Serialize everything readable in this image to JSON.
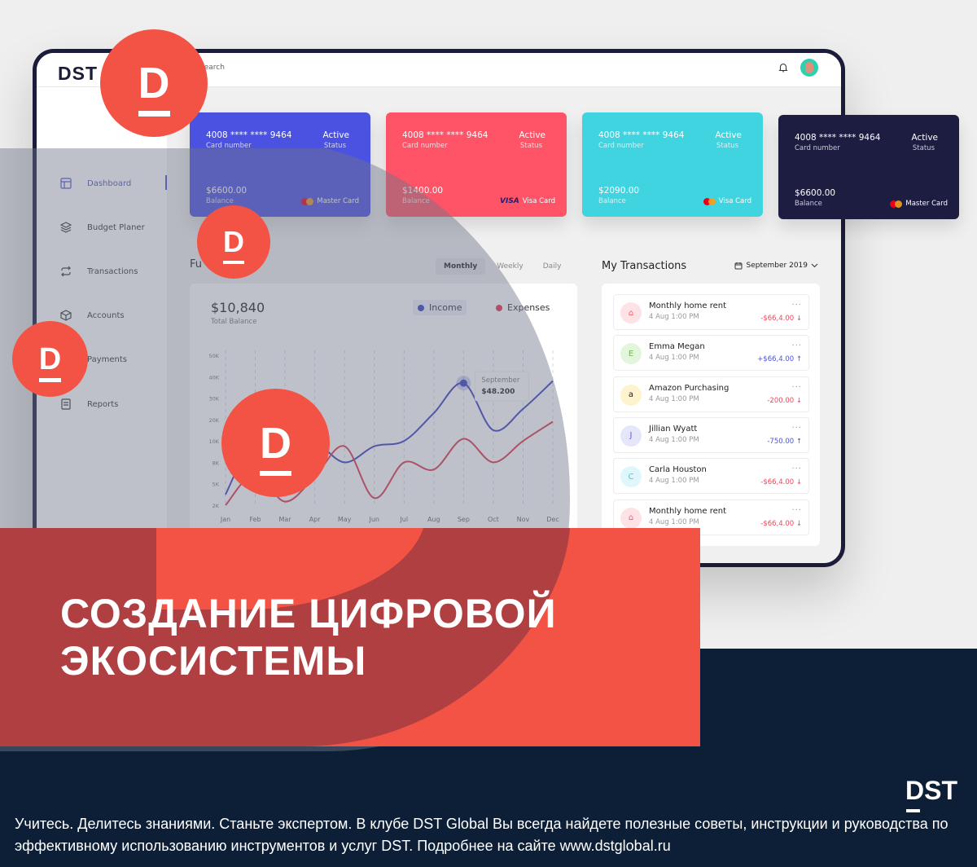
{
  "app": {
    "logo": "DST",
    "search_placeholder": "Search"
  },
  "sidebar": {
    "items": [
      {
        "label": "Dashboard",
        "icon": "layout-icon",
        "active": true
      },
      {
        "label": "Budget Planer",
        "icon": "layers-icon"
      },
      {
        "label": "Transactions",
        "icon": "repeat-icon"
      },
      {
        "label": "Accounts",
        "icon": "box-icon"
      },
      {
        "label": "Payments",
        "icon": "credit-card-icon"
      },
      {
        "label": "Reports",
        "icon": "report-icon"
      }
    ]
  },
  "cards": [
    {
      "number": "4008 **** **** 9464",
      "number_label": "Card number",
      "status": "Active",
      "status_label": "Status",
      "balance": "$6600.00",
      "balance_label": "Balance",
      "brand": "Master Card",
      "color": "#4b51e0"
    },
    {
      "number": "4008 **** **** 9464",
      "number_label": "Card number",
      "status": "Active",
      "status_label": "Status",
      "balance": "$1400.00",
      "balance_label": "Balance",
      "brand": "Visa Card",
      "brand_mark": "VISA",
      "color": "#ff5468"
    },
    {
      "number": "4008 **** **** 9464",
      "number_label": "Card number",
      "status": "Active",
      "status_label": "Status",
      "balance": "$2090.00",
      "balance_label": "Balance",
      "brand": "Visa Card",
      "color": "#3fd4e0"
    },
    {
      "number": "4008 **** **** 9464",
      "number_label": "Card number",
      "status": "Active",
      "status_label": "Status",
      "balance": "$6600.00",
      "balance_label": "Balance",
      "brand": "Master Card",
      "color": "#1d1d42"
    }
  ],
  "funds": {
    "title": "Funds Overview",
    "visible_title_prefix": "Fu",
    "visible_title_suffix": "w",
    "tabs": [
      "Monthly",
      "Weekly",
      "Daily"
    ],
    "active_tab": "Monthly",
    "total": "$10,840",
    "total_label": "Total Balance",
    "legend": [
      {
        "label": "Income",
        "color": "#3a3fc4"
      },
      {
        "label": "Expenses",
        "color": "#e0344f"
      }
    ],
    "tooltip": {
      "month": "September",
      "value": "$48.200"
    }
  },
  "chart_data": {
    "type": "line",
    "title": "",
    "xlabel": "",
    "ylabel": "",
    "categories": [
      "Jan",
      "Feb",
      "Mar",
      "Apr",
      "May",
      "Jun",
      "Jul",
      "Aug",
      "Sep",
      "Oct",
      "Nov",
      "Dec"
    ],
    "y_ticks": [
      "2K",
      "5K",
      "8K",
      "10K",
      "20K",
      "30K",
      "40K",
      "50K"
    ],
    "series": [
      {
        "name": "Income",
        "color": "#3a3fc4",
        "values": [
          3.5,
          12,
          14,
          10,
          8,
          9.5,
          10,
          23,
          37,
          15,
          25,
          38
        ]
      },
      {
        "name": "Expenses",
        "color": "#e0344f",
        "values": [
          2,
          6.5,
          2.5,
          6,
          9.5,
          3,
          8,
          7,
          11,
          8,
          10,
          19
        ]
      }
    ],
    "highlight": {
      "series": "Income",
      "category": "Sep",
      "label": "September",
      "value": "$48.200"
    },
    "grid": "vertical-dashed",
    "legend_position": "top-right"
  },
  "transactions": {
    "title": "My Transactions",
    "period": "September 2019",
    "items": [
      {
        "name": "Monthly home rent",
        "time": "4 Aug 1:00 PM",
        "amount": "-$66,4.00 ↓",
        "type": "out",
        "avatar": "airbnb",
        "avatar_bg": "#fde3e6",
        "avatar_fg": "#f05a6a"
      },
      {
        "name": "Emma Megan",
        "time": "4 Aug 1:00 PM",
        "amount": "+$66,4.00 ↑",
        "type": "in",
        "avatar": "E",
        "avatar_bg": "#e3f5dc",
        "avatar_fg": "#6bbf3c"
      },
      {
        "name": "Amazon Purchasing",
        "time": "4 Aug 1:00 PM",
        "amount": "-200.00 ↓",
        "type": "out",
        "avatar": "a",
        "avatar_bg": "#fff3cf",
        "avatar_fg": "#222"
      },
      {
        "name": "Jillian Wyatt",
        "time": "4 Aug 1:00 PM",
        "amount": "-750.00 ↑",
        "type": "in",
        "avatar": "J",
        "avatar_bg": "#e6e6fb",
        "avatar_fg": "#5a5fd6"
      },
      {
        "name": "Carla Houston",
        "time": "4 Aug 1:00 PM",
        "amount": "-$66,4.00 ↓",
        "type": "out",
        "avatar": "C",
        "avatar_bg": "#dff7fb",
        "avatar_fg": "#3fcfe0"
      },
      {
        "name": "Monthly home rent",
        "time": "4 Aug 1:00 PM",
        "amount": "-$66,4.00 ↓",
        "type": "out",
        "avatar": "airbnb",
        "avatar_bg": "#fde3e6",
        "avatar_fg": "#f05a6a"
      }
    ],
    "more_label": "..."
  },
  "promo": {
    "headline_line1": "СОЗДАНИЕ ЦИФРОВОЙ",
    "headline_line2": "ЭКОСИСТЕМЫ",
    "badge_letter": "D",
    "footer_logo": "DST",
    "footer_text": "Учитесь. Делитесь знаниями. Станьте экспертом. В клубе DST Global Вы всегда найдете полезные советы, инструкции и руководства по эффективному использованию инструментов и услуг DST. Подробнее на сайте www.dstglobal.ru",
    "accent": "#f25345",
    "footer_bg": "#0d1f37"
  }
}
